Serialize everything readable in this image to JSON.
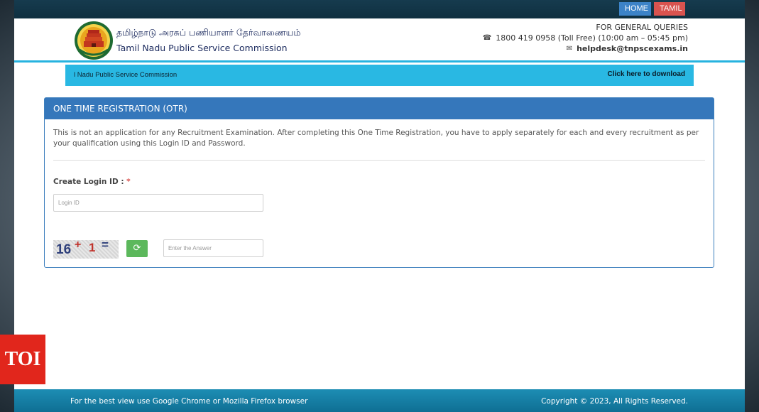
{
  "topbar": {
    "home_label": "HOME",
    "tamil_label": "TAMIL"
  },
  "header": {
    "org_name_tamil": "தமிழ்நாடு அரசுப் பணியாளர் தேர்வாணையம்",
    "org_name": "Tamil Nadu Public Service Commission",
    "queries_title": "FOR GENERAL QUERIES",
    "phone": "1800 419 0958 (Toll Free)  (10:00 am – 05:45 pm)",
    "email": "helpdesk@tnpscexams.in"
  },
  "marquee": {
    "text": "l Nadu Public Service Commission",
    "download_link": "Click here to download"
  },
  "panel": {
    "title": "ONE TIME REGISTRATION (OTR)",
    "note": "This is not an application for any Recruitment Examination. After completing this One Time Registration, you have to apply separately for each and every recruitment as per your qualification using this Login ID and Password.",
    "login_label": "Create Login ID :",
    "required_mark": "*",
    "login_placeholder": "Login ID",
    "captcha": {
      "a": "16",
      "op": "+",
      "b": "1",
      "eq": "="
    },
    "answer_placeholder": "Enter the Answer"
  },
  "badge": {
    "text": "TOI"
  },
  "footer": {
    "left": "For the best view use Google Chrome or Mozilla Firefox browser",
    "right": "Copyright © 2023, All Rights Reserved."
  },
  "colors": {
    "accent": "#3577bb",
    "marquee": "#29b8e3",
    "home_button": "#3c83c8",
    "tamil_button": "#d9534f",
    "refresh_button": "#5cb85c",
    "badge": "#e1261c"
  },
  "icons": [
    "emblem-logo",
    "phone-icon",
    "envelope-icon",
    "refresh-icon"
  ]
}
